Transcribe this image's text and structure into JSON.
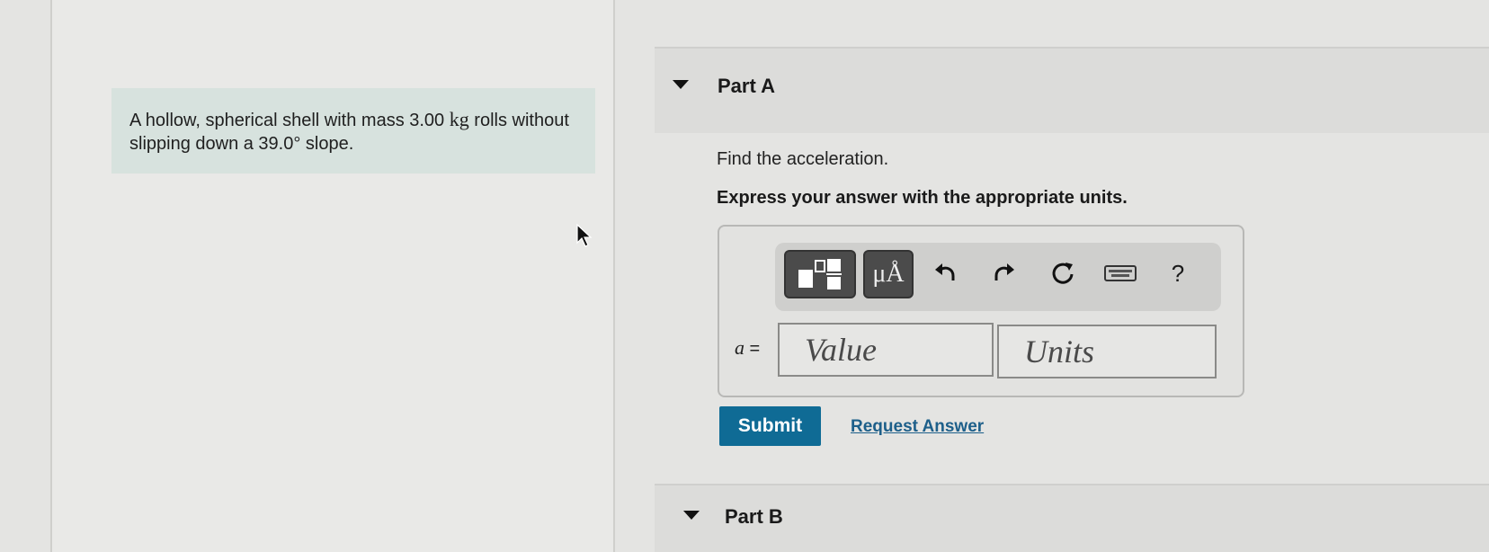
{
  "problem": {
    "text_before_mass": "A hollow, spherical shell with mass 3.00 ",
    "mass_unit": "kg",
    "text_after_mass": " rolls without slipping down a 39.0° slope."
  },
  "part_a": {
    "title": "Part A",
    "question": "Find the acceleration.",
    "instruction": "Express your answer with the appropriate units.",
    "toolbar": {
      "templates_icon": "fraction-templates-icon",
      "units_label": "μÅ",
      "undo_icon": "undo-icon",
      "redo_icon": "redo-icon",
      "reset_icon": "reset-icon",
      "keyboard_icon": "keyboard-icon",
      "help_label": "?"
    },
    "variable_name": "a",
    "variable_eq": " =",
    "value_placeholder": "Value",
    "units_placeholder": "Units",
    "submit_label": "Submit",
    "request_answer_label": "Request Answer"
  },
  "part_b": {
    "title": "Part B"
  },
  "colors": {
    "submit_bg": "#0f6b95",
    "link": "#1d5f8a",
    "problem_bg": "#d7e2de"
  }
}
